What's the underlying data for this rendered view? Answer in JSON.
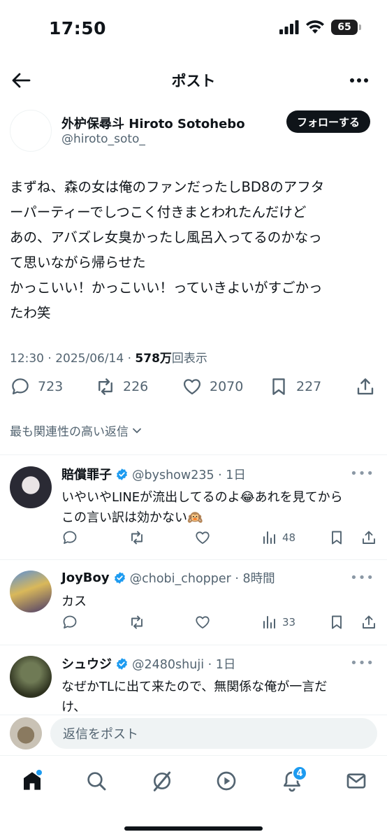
{
  "status_bar": {
    "time": "17:50",
    "battery": "65"
  },
  "header": {
    "title": "ポスト"
  },
  "author": {
    "name": "外枦保尋斗 Hiroto Sotohebo",
    "handle": "@hiroto_soto_",
    "follow_label": "フォローする"
  },
  "post": {
    "lines": [
      "まずね、森の女は俺のファンだったしBD8のアフタ",
      "ーパーティーでしつこく付きまとわれたんだけど",
      "あの、アバズレ女臭かったし風呂入ってるのかなっ",
      "て思いながら帰らせた",
      "かっこいい！かっこいい！っていきよいがすごかっ",
      "たわ笑"
    ],
    "time": "12:30 · 2025/06/14 · ",
    "views_count": "578万",
    "views_label": "回表示",
    "replies": "723",
    "reposts": "226",
    "likes": "2070",
    "bookmarks": "227"
  },
  "sort_label": "最も関連性の高い返信",
  "replies": [
    {
      "name": "賠償罪子",
      "handle": "@byshow235 · 1日",
      "lines": [
        "いやいやLINEが流出してるのよ😂あれを見てから",
        "この言い訳は効かない🙉"
      ],
      "views": "48"
    },
    {
      "name": "JoyBoy",
      "handle": "@chobi_chopper · 8時間",
      "lines": [
        "カス"
      ],
      "views": "33"
    },
    {
      "name": "シュウジ",
      "handle": "@2480shuji · 1日",
      "lines": [
        "なぜかTLに出て来たので、無関係な俺が一言だ",
        "け、"
      ]
    }
  ],
  "compose": {
    "placeholder": "返信をポスト"
  },
  "tabbar": {
    "notification_count": "4"
  },
  "colors": {
    "accent": "#1d9bf0",
    "text": "#0f1419",
    "secondary": "#536471"
  }
}
